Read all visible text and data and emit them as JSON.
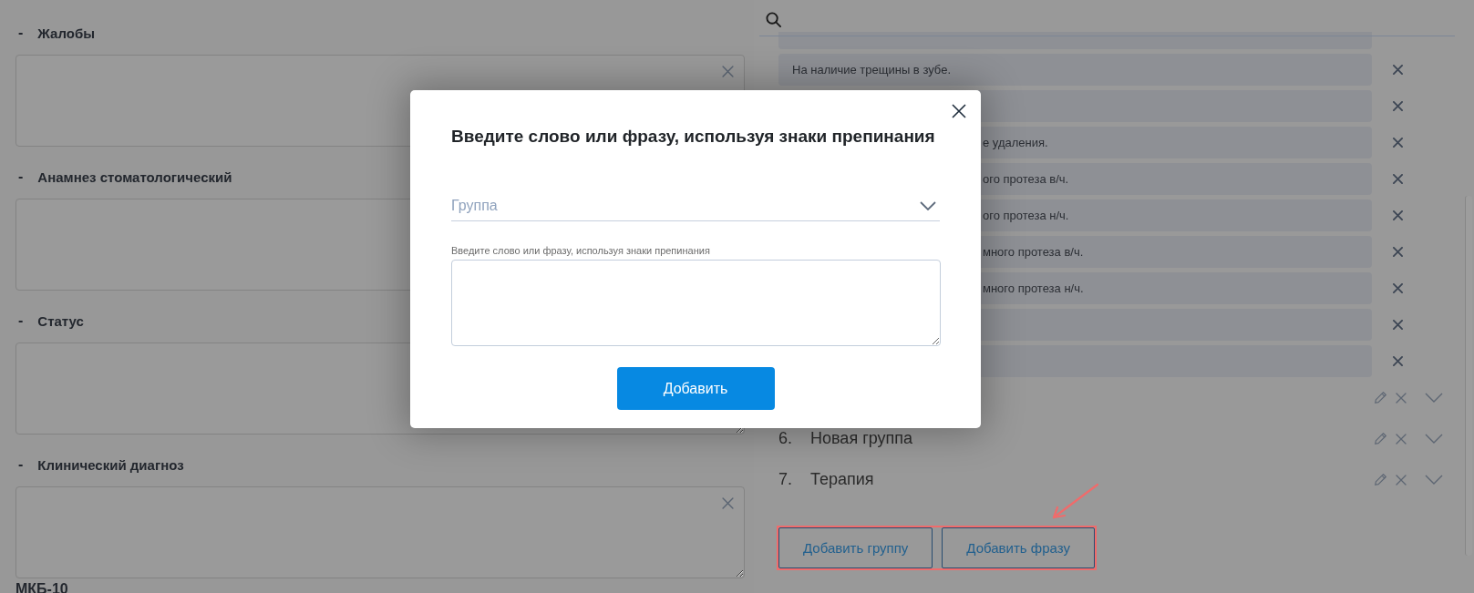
{
  "form": {
    "sections": [
      {
        "toggle": "-",
        "title": "Жалобы",
        "clear_icon": true
      },
      {
        "toggle": "-",
        "title": "Анамнез стоматологический",
        "clear_icon": false
      },
      {
        "toggle": "-",
        "title": "Статус",
        "clear_icon": false
      },
      {
        "toggle": "-",
        "title": "Клинический диагноз",
        "clear_icon": true
      }
    ],
    "next_heading": "МКБ-10"
  },
  "phrases_panel": {
    "phrases": [
      {
        "kind": "cut"
      },
      {
        "kind": "plain",
        "text": "На наличие трещины в зубе."
      },
      {
        "kind": "covered"
      },
      {
        "kind": "covered",
        "text": "е удаления."
      },
      {
        "kind": "covered",
        "text": "ого протеза в/ч."
      },
      {
        "kind": "covered",
        "text": "ого протеза н/ч."
      },
      {
        "kind": "covered",
        "text": "много протеза в/ч."
      },
      {
        "kind": "covered",
        "text": "много протеза н/ч."
      },
      {
        "kind": "covered"
      },
      {
        "kind": "covered"
      }
    ],
    "groups": [
      {
        "kind": "covered"
      },
      {
        "kind": "plain",
        "number": "6.",
        "name": "Новая группа"
      },
      {
        "kind": "plain",
        "number": "7.",
        "name": "Терапия"
      }
    ],
    "buttons": [
      "Добавить группу",
      "Добавить фразу"
    ]
  },
  "dialog": {
    "title": "Введите слово или фразу, используя знаки препинания",
    "group_select": {
      "placeholder": "Группа"
    },
    "phrase_field": {
      "label": "Введите слово или фразу, используя знаки препинания"
    },
    "submit_button": "Добавить"
  }
}
